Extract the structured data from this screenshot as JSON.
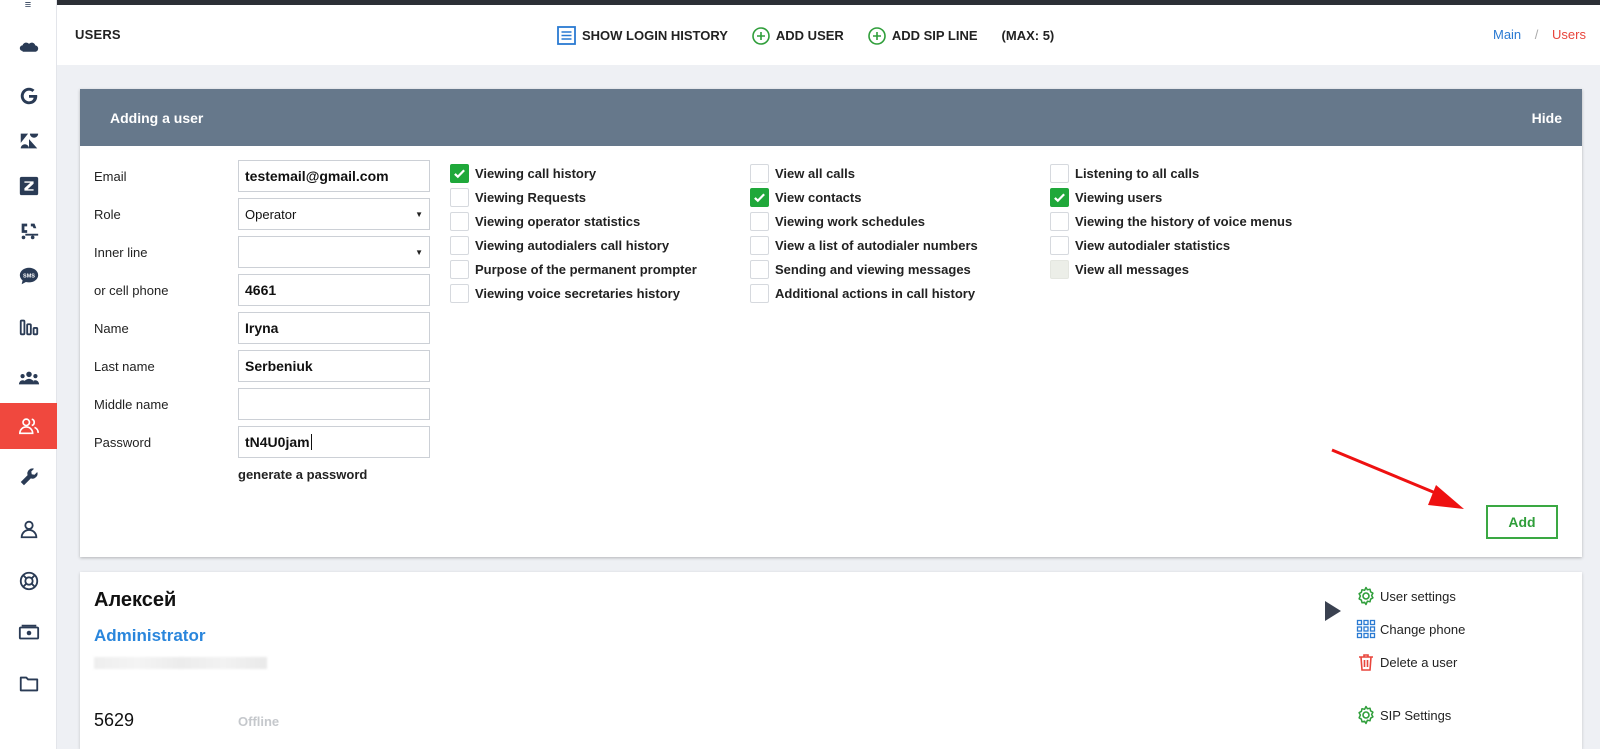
{
  "header": {
    "page_label": "USERS",
    "show_login_history": "SHOW LOGIN HISTORY",
    "add_user": "ADD USER",
    "add_sip_line": "ADD SIP LINE",
    "max": "(MAX: 5)"
  },
  "breadcrumb": {
    "main": "Main",
    "sep": "/",
    "current": "Users"
  },
  "panel": {
    "title": "Adding a user",
    "hide": "Hide",
    "labels": {
      "email": "Email",
      "role": "Role",
      "inner_line": "Inner line",
      "cell_phone": "or cell phone",
      "name": "Name",
      "last_name": "Last name",
      "middle_name": "Middle name",
      "password": "Password"
    },
    "values": {
      "email": "testemail@gmail.com",
      "role": "Operator",
      "inner_line": "",
      "cell_phone": "4661",
      "name": "Iryna",
      "last_name": "Serbeniuk",
      "middle_name": "",
      "password": "tN4U0jam"
    },
    "generate_password": "generate a password",
    "add_button": "Add",
    "permissions": {
      "col1": [
        {
          "label": "Viewing call history",
          "checked": true
        },
        {
          "label": "Viewing Requests",
          "checked": false
        },
        {
          "label": "Viewing operator statistics",
          "checked": false
        },
        {
          "label": "Viewing autodialers call history",
          "checked": false
        },
        {
          "label": "Purpose of the permanent prompter",
          "checked": false
        },
        {
          "label": "Viewing voice secretaries history",
          "checked": false
        }
      ],
      "col2": [
        {
          "label": "View all calls",
          "checked": false
        },
        {
          "label": "View contacts",
          "checked": true
        },
        {
          "label": "Viewing work schedules",
          "checked": false
        },
        {
          "label": "View a list of autodialer numbers",
          "checked": false
        },
        {
          "label": "Sending and viewing messages",
          "checked": false
        },
        {
          "label": "Additional actions in call history",
          "checked": false
        }
      ],
      "col3": [
        {
          "label": "Listening to all calls",
          "checked": false
        },
        {
          "label": "Viewing users",
          "checked": true
        },
        {
          "label": "Viewing the history of voice menus",
          "checked": false
        },
        {
          "label": "View autodialer statistics",
          "checked": false
        },
        {
          "label": "View all messages",
          "checked": false,
          "disabled": true
        }
      ]
    }
  },
  "user_card": {
    "name": "Алексей",
    "role": "Administrator",
    "phone": "5629",
    "status": "Offline",
    "actions": {
      "settings": "User settings",
      "change_phone": "Change phone",
      "delete": "Delete a user",
      "sip": "SIP Settings"
    }
  },
  "colors": {
    "accent_red": "#f0483e",
    "panel_header": "#66788b",
    "check_green": "#1fa83a",
    "link_blue": "#2a7ad2"
  }
}
